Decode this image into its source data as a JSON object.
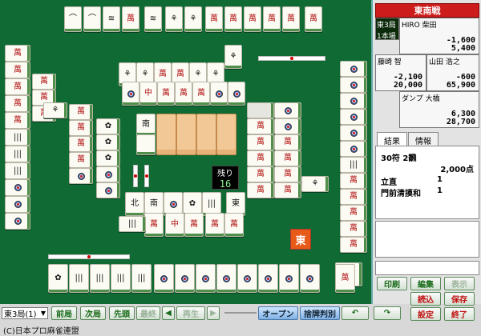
{
  "match": {
    "title": "東南戦",
    "round": "東3局",
    "honba": "1本場"
  },
  "wall_remaining": {
    "label": "残り",
    "count": "16"
  },
  "dealer_marker": "東",
  "players": [
    {
      "name": "HIRO 柴田",
      "diff": "-1,600",
      "score": "5,400"
    },
    {
      "name": "藤崎 智",
      "diff": "-2,100",
      "score": "20,000"
    },
    {
      "name": "山田 浩之",
      "diff": "-600",
      "score": "65,900"
    },
    {
      "name": "ダンプ 大橋",
      "diff": "6,300",
      "score": "28,700"
    }
  ],
  "tabs": [
    "結果",
    "情報"
  ],
  "result": {
    "fu_han": "30符 2飜",
    "points": "2,000点",
    "yaku": [
      {
        "name": "立直",
        "han": "1"
      },
      {
        "name": "門前清摸和",
        "han": "1"
      }
    ]
  },
  "side_buttons": [
    "印刷",
    "編集",
    "表示",
    "読込",
    "保存",
    "設定",
    "終了"
  ],
  "controls": {
    "round_select": "東3局(1)",
    "prev_round": "前局",
    "next_round": "次局",
    "first": "先頭",
    "last": "最終",
    "play": "再生",
    "open": "オープン",
    "discard_judge": "捨牌判別"
  },
  "copyright": "(C)日本プロ麻雀連盟",
  "colors": {
    "felt": "#0f6a33",
    "accent": "#cd1c1c",
    "tile_back": "#f2c996"
  }
}
